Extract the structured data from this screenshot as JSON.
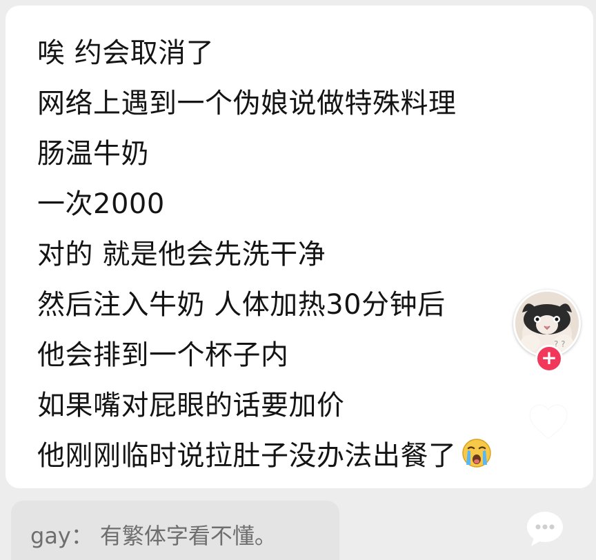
{
  "post": {
    "lines": [
      "唉 约会取消了",
      "网络上遇到一个伪娘说做特殊料理",
      "肠温牛奶",
      "一次2000",
      "对的 就是他会先洗干净",
      "然后注入牛奶 人体加热30分钟后",
      "他会排到一个杯子内",
      "如果嘴对屁眼的话要加价",
      "他刚刚临时说拉肚子没办法出餐了"
    ],
    "trailing_emoji": "crying-face-icon"
  },
  "side_actions": {
    "follow_label": "+",
    "like_icon": "heart-icon",
    "comment_icon": "chat-bubble-icon"
  },
  "comment": {
    "user": "gay",
    "separator": "：",
    "text": "有繁体字看不懂。"
  },
  "colors": {
    "follow": "#f2385a",
    "text": "#141414",
    "comment_text": "#6e6e6e"
  }
}
